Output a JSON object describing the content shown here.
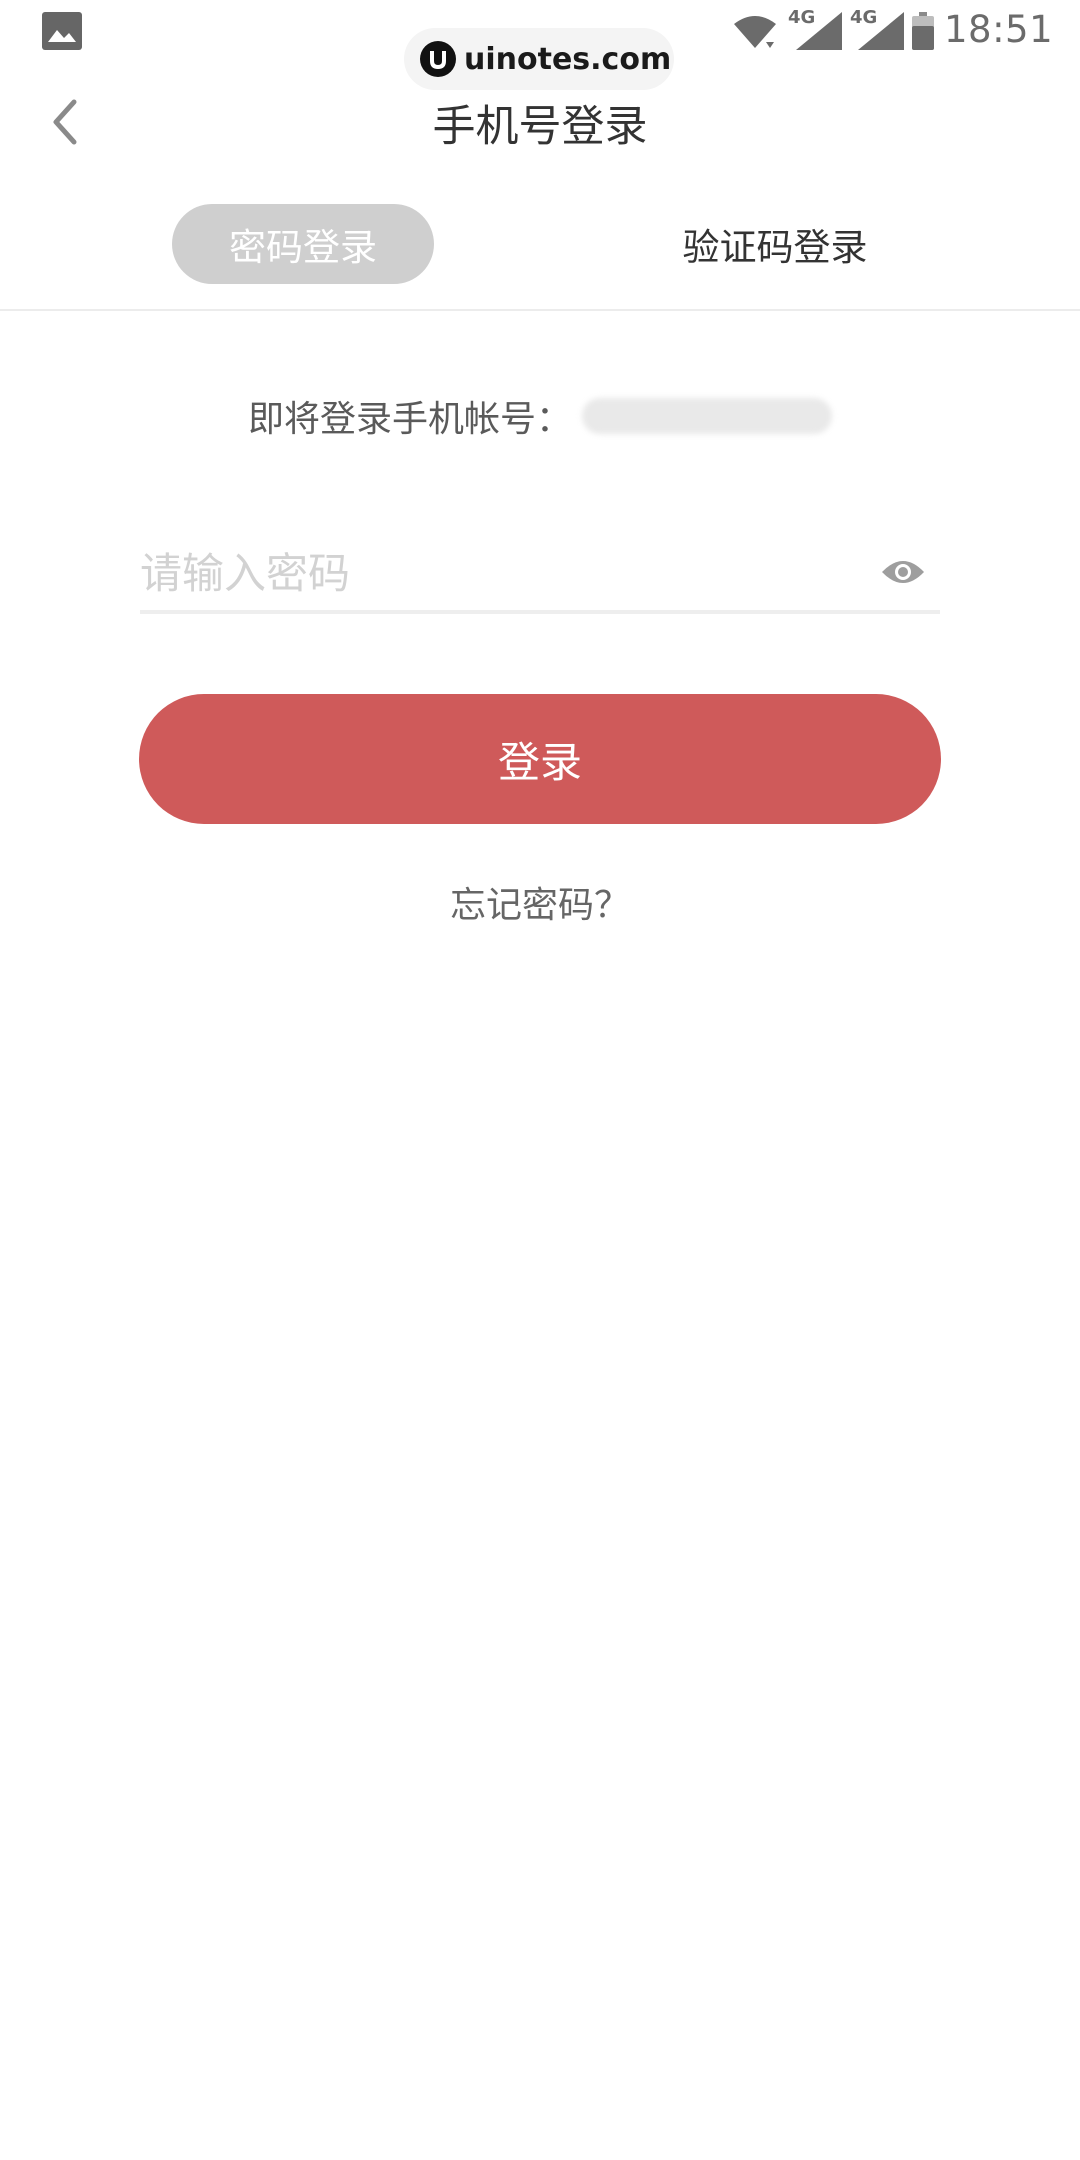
{
  "status_bar": {
    "time": "18:51",
    "network_1": "4G",
    "network_2": "4G",
    "icons": [
      "gallery-icon",
      "wifi-icon",
      "signal-icon",
      "signal-icon",
      "battery-icon"
    ]
  },
  "watermark": {
    "text": "uinotes.com"
  },
  "header": {
    "title": "手机号登录",
    "back_icon": "chevron-left-icon"
  },
  "tabs": [
    {
      "label": "密码登录",
      "active": true
    },
    {
      "label": "验证码登录",
      "active": false
    }
  ],
  "account": {
    "label": "即将登录手机帐号："
  },
  "password_field": {
    "placeholder": "请输入密码",
    "value": "",
    "toggle_icon": "eye-icon"
  },
  "login_button": {
    "label": "登录"
  },
  "forgot_link": {
    "label": "忘记密码？"
  },
  "colors": {
    "accent": "#cf5a5a",
    "tab_active_bg": "#cfcfcf",
    "text_primary": "#333333",
    "text_secondary": "#666666"
  }
}
